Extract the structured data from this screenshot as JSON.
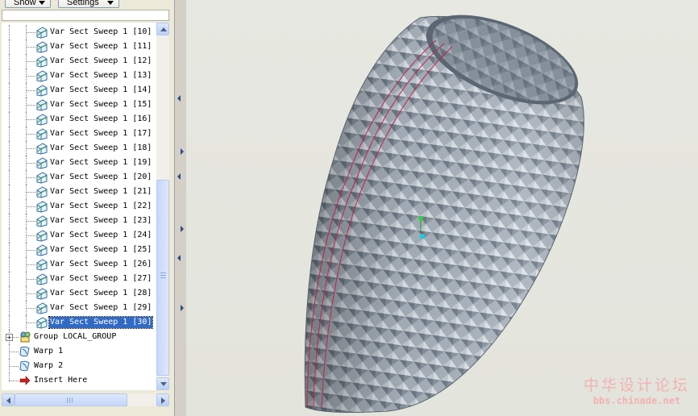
{
  "toolbar": {
    "show_label": "Show",
    "settings_label": "Settings"
  },
  "tree": {
    "sweep_items": [
      "Var Sect Sweep 1 [10]",
      "Var Sect Sweep 1 [11]",
      "Var Sect Sweep 1 [12]",
      "Var Sect Sweep 1 [13]",
      "Var Sect Sweep 1 [14]",
      "Var Sect Sweep 1 [15]",
      "Var Sect Sweep 1 [16]",
      "Var Sect Sweep 1 [17]",
      "Var Sect Sweep 1 [18]",
      "Var Sect Sweep 1 [19]",
      "Var Sect Sweep 1 [20]",
      "Var Sect Sweep 1 [21]",
      "Var Sect Sweep 1 [22]",
      "Var Sect Sweep 1 [23]",
      "Var Sect Sweep 1 [24]",
      "Var Sect Sweep 1 [25]",
      "Var Sect Sweep 1 [26]",
      "Var Sect Sweep 1 [27]",
      "Var Sect Sweep 1 [28]",
      "Var Sect Sweep 1 [29]",
      "Var Sect Sweep 1 [30]"
    ],
    "selected_item": "Var Sect Sweep 1 [30]",
    "group_label": "Group LOCAL_GROUP",
    "warp1_label": "Warp 1",
    "warp2_label": "Warp 2",
    "insert_label": "Insert Here",
    "icons": {
      "sweep": "sweep-feature-icon",
      "group": "group-icon",
      "warp": "warp-icon",
      "insert": "insert-here-arrow-icon"
    }
  },
  "viewport": {
    "model_color": "#8e9aa6",
    "curve_color": "#c0224a"
  },
  "watermark": {
    "text_cn": "中华设计论坛",
    "url": "bbs.chinade.net",
    "color": "#f2b2b2"
  }
}
